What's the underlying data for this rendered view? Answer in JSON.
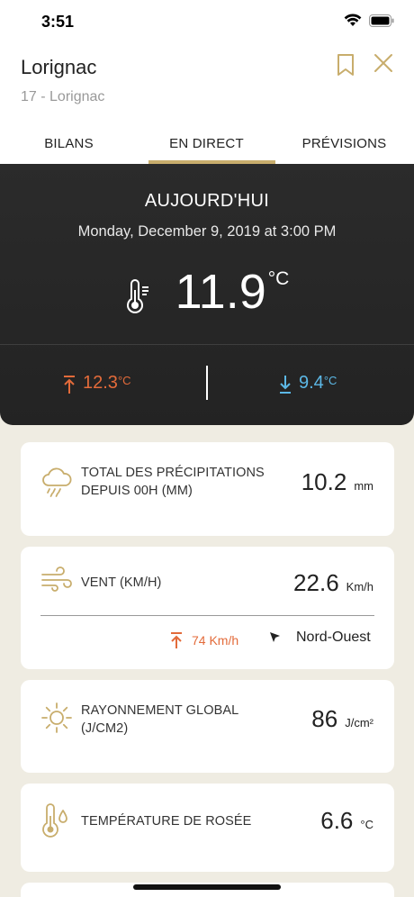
{
  "status_bar": {
    "time": "3:51"
  },
  "header": {
    "station_name": "Lorignac",
    "station_sub": "17 - Lorignac"
  },
  "tabs": [
    {
      "label": "BILANS",
      "active": false
    },
    {
      "label": "EN DIRECT",
      "active": true
    },
    {
      "label": "PRÉVISIONS",
      "active": false
    }
  ],
  "hero": {
    "title": "AUJOURD'HUI",
    "date": "Monday, December 9, 2019 at 3:00 PM",
    "temperature": "11.9",
    "temperature_unit": "°C",
    "max": "12.3",
    "max_unit": "°C",
    "min": "9.4",
    "min_unit": "°C"
  },
  "cards": {
    "precip": {
      "label_line1": "TOTAL DES PRÉCIPITATIONS",
      "label_line2": "DEPUIS 00H (MM)",
      "value": "10.2",
      "unit": "mm"
    },
    "wind": {
      "label": "VENT (KM/H)",
      "value": "22.6",
      "unit": "Km/h",
      "gust": "74 Km/h",
      "direction": "Nord-Ouest"
    },
    "radiation": {
      "label_line1": "RAYONNEMENT GLOBAL",
      "label_line2": "(J/CM2)",
      "value": "86",
      "unit": "J/cm²"
    },
    "dewpoint": {
      "label": "TEMPÉRATURE DE ROSÉE",
      "value": "6.6",
      "unit": "°C"
    }
  },
  "colors": {
    "accent": "#c8ad6c",
    "max_red": "#e36b3a",
    "min_blue": "#5cb8e6",
    "hero_bg": "#262626",
    "page_bg": "#efece2"
  }
}
